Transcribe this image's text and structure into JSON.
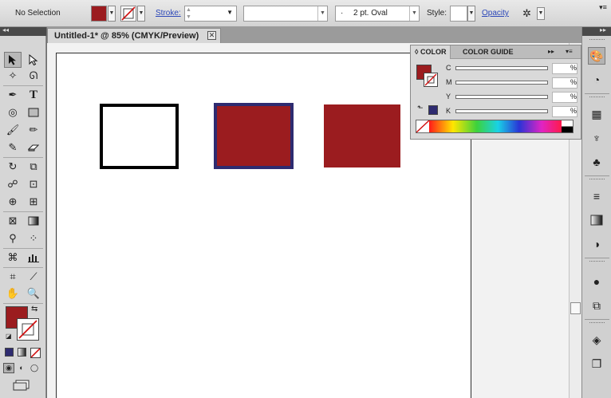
{
  "control_bar": {
    "selection_label": "No Selection",
    "stroke_label": "Stroke:",
    "brush_value": "2 pt. Oval",
    "brush_prefix": "·",
    "style_label": "Style:",
    "opacity_label": "Opacity",
    "fill_color": "#9b1c1f"
  },
  "document_tab": {
    "title": "Untitled-1* @ 85% (CMYK/Preview)",
    "close_glyph": "✕"
  },
  "tools": {
    "panel_collapse_glyph": "◂◂",
    "fill_color": "#9b1c1f",
    "icons": [
      "selection-tool-icon",
      "direct-selection-tool-icon",
      "magic-wand-tool-icon",
      "lasso-tool-icon",
      "pen-tool-icon",
      "type-tool-icon",
      "spiral-tool-icon",
      "rectangle-tool-icon",
      "paintbrush-tool-icon",
      "pencil-tool-icon",
      "blob-brush-tool-icon",
      "eraser-tool-icon",
      "rotate-tool-icon",
      "scale-tool-icon",
      "warp-tool-icon",
      "free-transform-tool-icon",
      "shape-builder-tool-icon",
      "perspective-grid-tool-icon",
      "mesh-tool-icon",
      "gradient-tool-icon",
      "eyedropper-tool-icon",
      "blend-tool-icon",
      "symbol-sprayer-tool-icon",
      "column-graph-tool-icon",
      "artboard-tool-icon",
      "slice-tool-icon",
      "hand-tool-icon",
      "zoom-tool-icon"
    ]
  },
  "artboard_shapes": [
    {
      "name": "white-rectangle",
      "fill": "#ffffff",
      "stroke": "#000000"
    },
    {
      "name": "red-rectangle-blue-stroke",
      "fill": "#9b1c1f",
      "stroke": "#2e2b70"
    },
    {
      "name": "red-rectangle",
      "fill": "#9b1c1f",
      "stroke": "none"
    }
  ],
  "color_panel": {
    "tab_color": "COLOR",
    "tab_color_guide": "COLOR GUIDE",
    "tab_color_arrow": "◊",
    "menu_forward": "▸▸",
    "menu_glyph": "▾≡",
    "fill_color": "#9b1c1f",
    "out_of_gamut_color": "#2e2b70",
    "channels": [
      {
        "label": "C",
        "unit": "%"
      },
      {
        "label": "M",
        "unit": "%"
      },
      {
        "label": "Y",
        "unit": "%"
      },
      {
        "label": "K",
        "unit": "%"
      }
    ]
  },
  "dock": {
    "collapse_glyph": "▸▸",
    "icons": [
      "color-panel-icon",
      "color-guide-icon",
      "swatches-icon",
      "brushes-icon",
      "symbols-icon",
      "stroke-icon",
      "gradient-icon",
      "transparency-icon",
      "appearance-icon",
      "graphic-styles-icon",
      "layers-icon",
      "artboards-icon"
    ]
  }
}
